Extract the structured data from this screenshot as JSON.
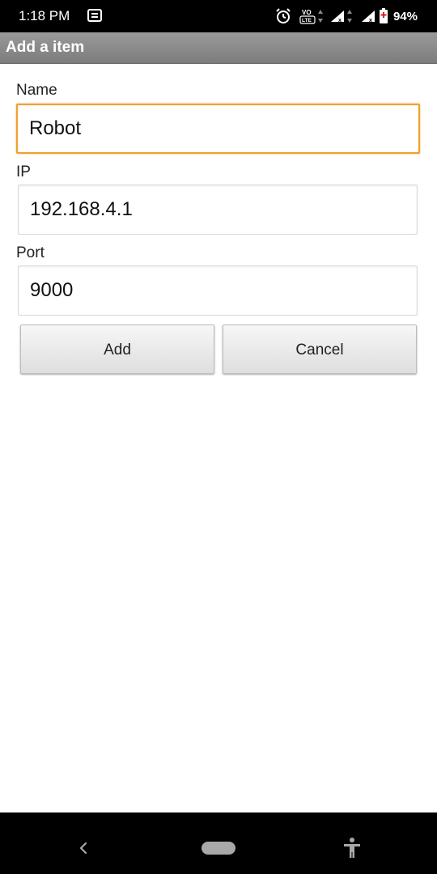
{
  "status_bar": {
    "time": "1:18 PM",
    "battery": "94%",
    "icons": [
      "notification-icon",
      "alarm-icon",
      "volte-icon",
      "signal-icon",
      "signal-icon",
      "battery-icon"
    ]
  },
  "header": {
    "title": "Add a item"
  },
  "form": {
    "name_label": "Name",
    "name_value": "Robot",
    "ip_label": "IP",
    "ip_value": "192.168.4.1",
    "port_label": "Port",
    "port_value": "9000"
  },
  "buttons": {
    "add_label": "Add",
    "cancel_label": "Cancel"
  },
  "nav_bar": {
    "icons": [
      "back-icon",
      "home-pill-icon",
      "accessibility-icon"
    ]
  },
  "colors": {
    "focus_border": "#f0a030",
    "title_bar": "#8a8a8a",
    "status_bar": "#000000"
  }
}
